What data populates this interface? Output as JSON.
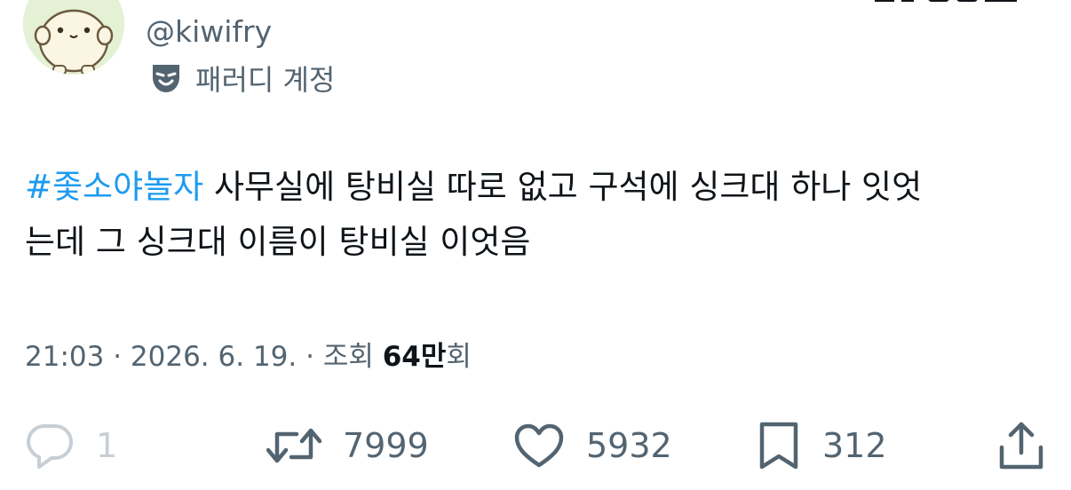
{
  "header": {
    "handle": "@kiwifry",
    "account_label": "패러디 계정",
    "avatar_icon": "rabbit-avatar",
    "label_icon": "theater-mask-icon"
  },
  "tweet": {
    "hashtag": "#좇소야놀자",
    "line1_rest": " 사무실에 탕비실 따로 없고 구석에 싱크대 하나 잇엇",
    "line2": "는데 그 싱크대 이름이 탕비실 이엇음"
  },
  "meta": {
    "time": "21:03",
    "sep1": " · ",
    "date": "2026. 6. 19.",
    "sep2": " · ",
    "views_label": "조회 ",
    "views_count": "64만",
    "views_suffix": "회"
  },
  "actions": {
    "reply_count": "1",
    "retweet_count": "7999",
    "like_count": "5932",
    "bookmark_count": "312"
  },
  "colors": {
    "accent": "#1d9bf0",
    "text": "#0f1419",
    "muted": "#536471",
    "disabled": "#c7ced5",
    "avatar_bg": "#e4f1d4"
  }
}
